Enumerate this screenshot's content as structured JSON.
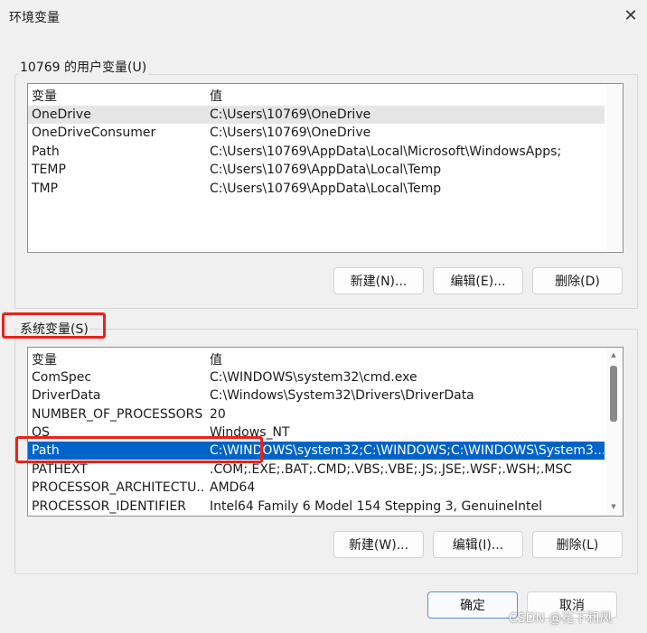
{
  "window": {
    "title": "环境变量",
    "close_glyph": "✕"
  },
  "user_vars": {
    "group_label": "10769 的用户变量(U)",
    "header": {
      "name": "变量",
      "value": "值"
    },
    "rows": [
      {
        "name": "OneDrive",
        "value": "C:\\Users\\10769\\OneDrive"
      },
      {
        "name": "OneDriveConsumer",
        "value": "C:\\Users\\10769\\OneDrive"
      },
      {
        "name": "Path",
        "value": "C:\\Users\\10769\\AppData\\Local\\Microsoft\\WindowsApps;"
      },
      {
        "name": "TEMP",
        "value": "C:\\Users\\10769\\AppData\\Local\\Temp"
      },
      {
        "name": "TMP",
        "value": "C:\\Users\\10769\\AppData\\Local\\Temp"
      }
    ],
    "buttons": {
      "new": "新建(N)...",
      "edit": "编辑(E)...",
      "delete": "删除(D)"
    }
  },
  "system_vars": {
    "group_label": "系统变量(S)",
    "header": {
      "name": "变量",
      "value": "值"
    },
    "rows": [
      {
        "name": "ComSpec",
        "value": "C:\\WINDOWS\\system32\\cmd.exe"
      },
      {
        "name": "DriverData",
        "value": "C:\\Windows\\System32\\Drivers\\DriverData"
      },
      {
        "name": "NUMBER_OF_PROCESSORS",
        "value": "20"
      },
      {
        "name": "OS",
        "value": "Windows_NT"
      },
      {
        "name": "Path",
        "value": "C:\\WINDOWS\\system32;C:\\WINDOWS;C:\\WINDOWS\\System3..."
      },
      {
        "name": "PATHEXT",
        "value": ".COM;.EXE;.BAT;.CMD;.VBS;.VBE;.JS;.JSE;.WSF;.WSH;.MSC"
      },
      {
        "name": "PROCESSOR_ARCHITECTU...",
        "value": "AMD64"
      },
      {
        "name": "PROCESSOR_IDENTIFIER",
        "value": "Intel64 Family 6 Model 154 Stepping 3, GenuineIntel"
      }
    ],
    "buttons": {
      "new": "新建(W)...",
      "edit": "编辑(I)...",
      "delete": "删除(L)"
    }
  },
  "footer": {
    "ok": "确定",
    "cancel": "取消"
  },
  "watermark": "CSDN @花下和风",
  "colors": {
    "selection": "#0063c8",
    "annotation_box": "#e8231b"
  }
}
